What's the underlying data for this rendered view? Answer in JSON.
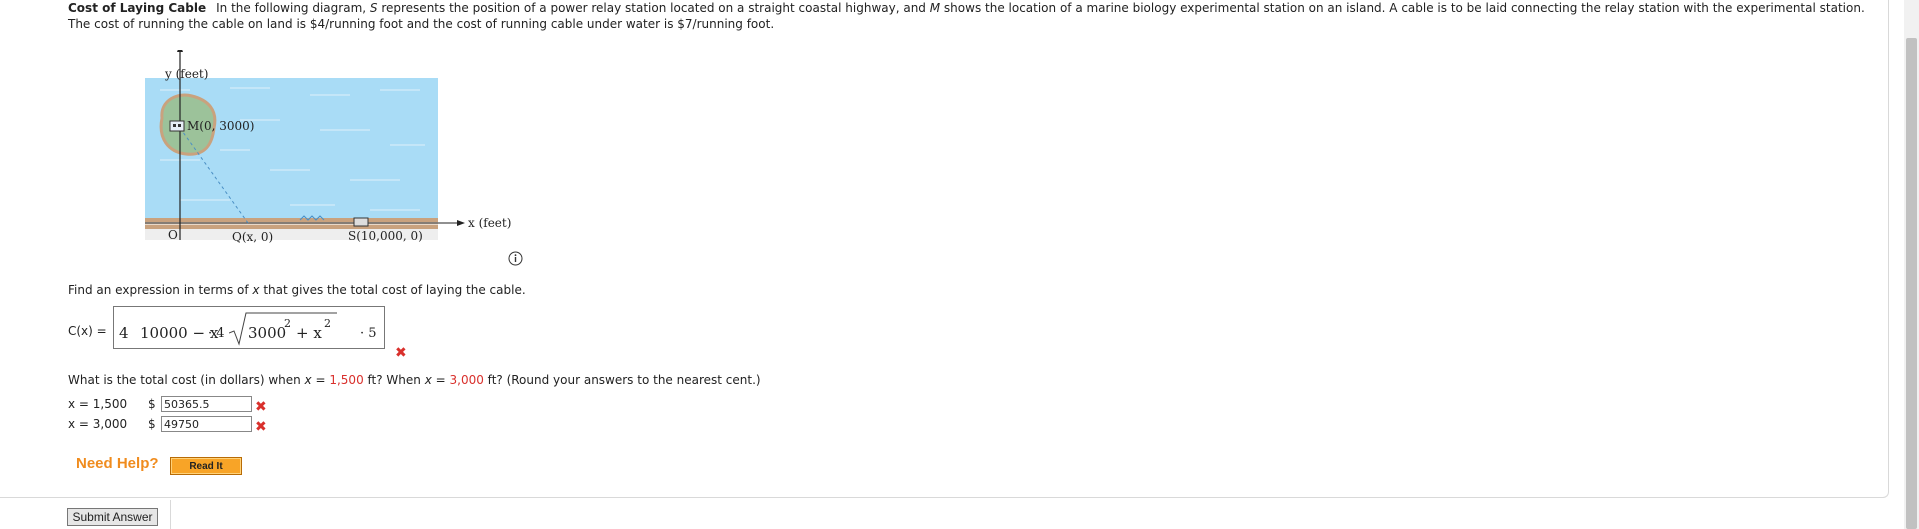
{
  "problem": {
    "title": "Cost of Laying Cable",
    "text_part1": "In the following diagram, ",
    "var_s": "S",
    "text_part2": " represents the position of a power relay station located on a straight coastal highway, and ",
    "var_m": "M",
    "text_part3": " shows the location of a marine biology experimental station on an island. A cable is to be laid connecting the relay station with the experimental station. The cost of running the cable on land is $4/running foot and the cost of running cable under water is $7/running foot."
  },
  "diagram": {
    "y_axis_label": "y (feet)",
    "x_axis_label": "x (feet)",
    "label_m": "M(0, 3000)",
    "label_origin": "O",
    "label_q": "Q(x, 0)",
    "label_s": "S(10,000, 0)",
    "colors": {
      "water": "#a9dcf6",
      "land": "#c9a27e",
      "island": "#9cc29a"
    }
  },
  "question1": {
    "text_before": "Find an expression in terms of ",
    "var": "x",
    "text_after": " that gives the total cost of laying the cable."
  },
  "answer_expression": {
    "label": "C(x) =",
    "term1": "4",
    "term2": "10000 − x",
    "term3": "· 4",
    "radicand_base": "3000",
    "radicand_exp1": "2",
    "radicand_plus": "+ x",
    "radicand_exp2": "2",
    "term4": "· 5"
  },
  "question2": {
    "text1": "What is the total cost (in dollars) when ",
    "var1": "x",
    "eq1": " = ",
    "value1": "1,500",
    "text2": " ft? When ",
    "var2": "x",
    "eq2": " = ",
    "value2": "3,000",
    "text3": " ft? (Round your answers to the nearest cent.)"
  },
  "answers": [
    {
      "label": "x = 1,500",
      "currency": "$",
      "value": "50365.5"
    },
    {
      "label": "x = 3,000",
      "currency": "$",
      "value": "49750"
    }
  ],
  "help": {
    "need_help": "Need Help?",
    "read_it": "Read It"
  },
  "submit": {
    "label": "Submit Answer"
  }
}
